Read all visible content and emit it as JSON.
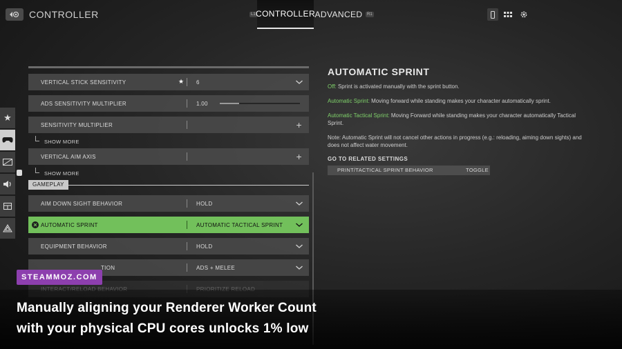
{
  "header": {
    "title": "CONTROLLER",
    "hint_left": "L1",
    "hint_right": "R1",
    "tabs": [
      {
        "label": "CONTROLLER",
        "active": true
      },
      {
        "label": "ADVANCED",
        "active": false
      }
    ],
    "icons": [
      "back-icon",
      "controller-mode-icon",
      "grid-icon",
      "gear-icon"
    ]
  },
  "sidebar": {
    "items": [
      {
        "icon": "star-icon",
        "active": false
      },
      {
        "icon": "gamepad-icon",
        "active": true
      },
      {
        "icon": "display-icon",
        "active": false
      },
      {
        "icon": "audio-icon",
        "active": false
      },
      {
        "icon": "interface-icon",
        "active": false
      },
      {
        "icon": "network-icon",
        "active": false
      }
    ]
  },
  "settings": {
    "rows": [
      {
        "label": "VERTICAL STICK SENSITIVITY",
        "value": "6",
        "starred": true,
        "control": "dropdown"
      },
      {
        "label": "ADS SENSITIVITY MULTIPLIER",
        "value": "1.00",
        "control": "slider",
        "level": 0.24
      },
      {
        "label": "SENSITIVITY MULTIPLIER",
        "value": "",
        "control": "expand"
      },
      {
        "label": "VERTICAL AIM AXIS",
        "value": "",
        "control": "expand"
      }
    ],
    "show_more": "SHOW MORE",
    "section": "GAMEPLAY",
    "gameplay_rows": [
      {
        "label": "AIM DOWN SIGHT BEHAVIOR",
        "value": "HOLD"
      },
      {
        "label": "AUTOMATIC SPRINT",
        "value": "AUTOMATIC TACTICAL SPRINT",
        "selected": true
      },
      {
        "label": "EQUIPMENT BEHAVIOR",
        "value": "HOLD"
      },
      {
        "label": "TION",
        "value": "ADS + MELEE"
      },
      {
        "label": "INTERACT/RELOAD BEHAVIOR",
        "value": "PRIORITIZE RELOAD"
      }
    ]
  },
  "detail": {
    "title": "AUTOMATIC SPRINT",
    "off_label": "Off:",
    "off_text": " Sprint is activated manually with the sprint button.",
    "auto_label": "Automatic Sprint:",
    "auto_text": " Moving forward while standing makes your character automatically sprint.",
    "tactical_label": "Automatic Tactical Sprint:",
    "tactical_text": " Moving Forward while standing makes your character automatically Tactical Sprint.",
    "note": "Note: Automatic Sprint will not cancel other actions in progress (e.g.: reloading, aiming down sights) and does not affect water movement.",
    "related_title": "GO TO RELATED SETTINGS",
    "related": {
      "label": "PRINT/TACTICAL SPRINT BEHAVIOR",
      "value": "TOGGLE"
    }
  },
  "watermark": "STEAMMOZ.COM",
  "caption": {
    "line1": "Manually aligning your Renderer Worker Count",
    "line2": "with your physical CPU cores unlocks 1% low"
  },
  "colors": {
    "accent_green": "#72c05b",
    "green_text": "#7fd16a",
    "watermark_purple": "#8d3fae"
  }
}
